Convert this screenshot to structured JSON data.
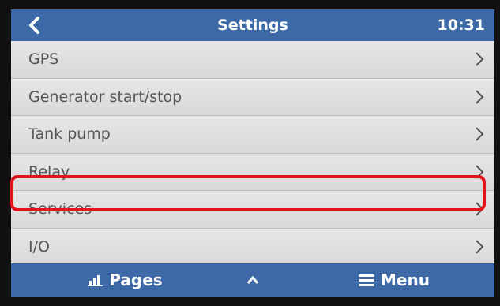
{
  "header": {
    "title": "Settings",
    "time": "10:31",
    "back_icon": "chevron-left-icon"
  },
  "menu": {
    "items": [
      {
        "label": "GPS"
      },
      {
        "label": "Generator start/stop"
      },
      {
        "label": "Tank pump"
      },
      {
        "label": "Relay"
      },
      {
        "label": "Services"
      },
      {
        "label": "I/O"
      }
    ],
    "highlighted_item": "Services"
  },
  "footer": {
    "pages_label": "Pages",
    "menu_label": "Menu",
    "up_icon": "chevron-up-icon"
  },
  "colors": {
    "bar_blue": "#3d6aa6",
    "list_bg": "#dcdcdc",
    "highlight_red": "#e3141b"
  }
}
